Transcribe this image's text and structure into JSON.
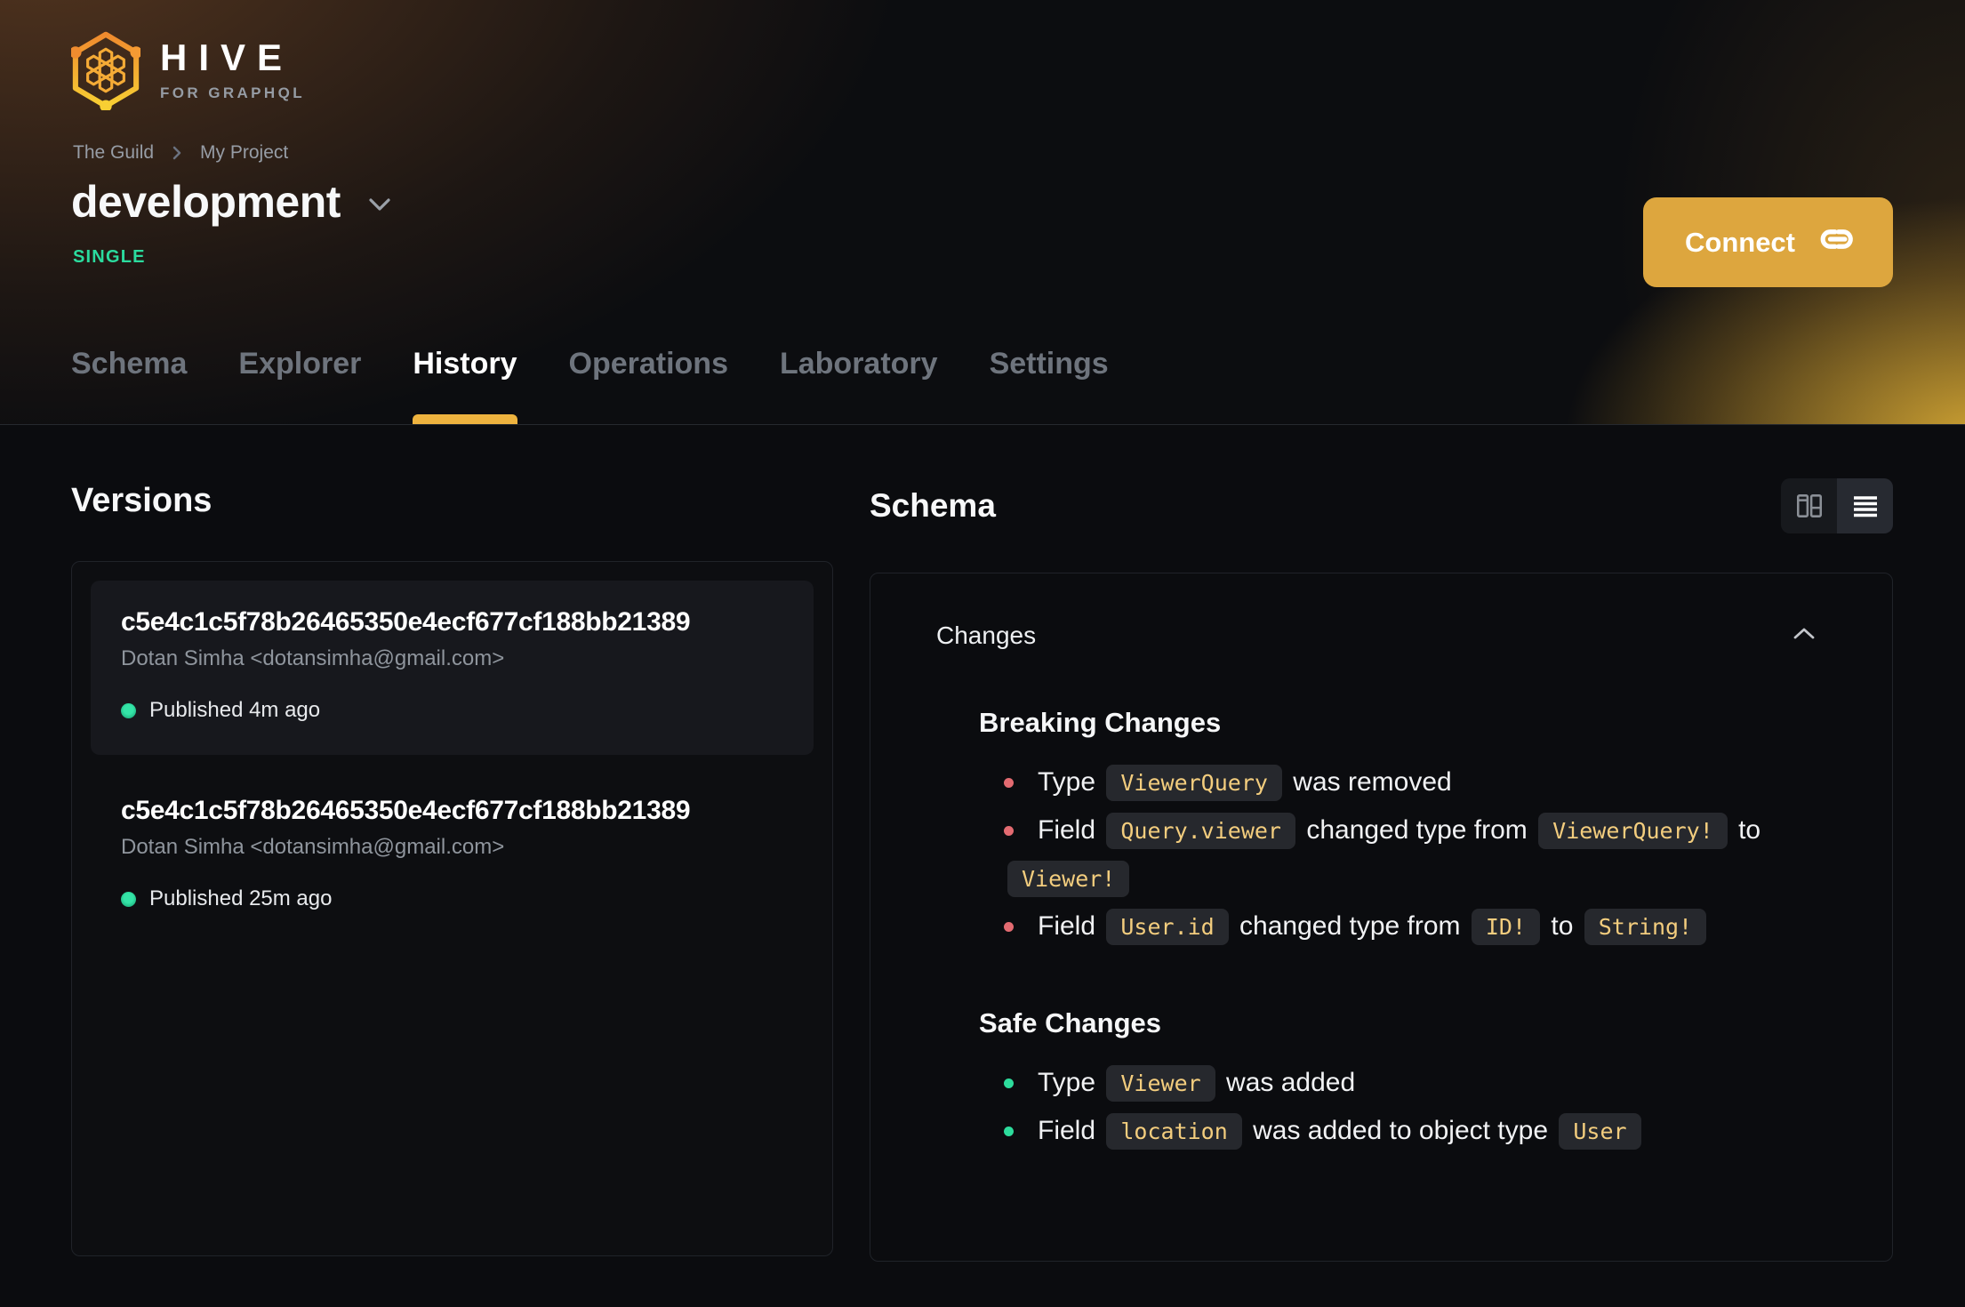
{
  "colors": {
    "accent": "#eeb33f",
    "connect_button": "#dda63e",
    "badge_green": "#2bdb9e",
    "breaking_bullet": "#e36b71",
    "safe_bullet": "#2ddc9c",
    "code_text": "#f3cd7e"
  },
  "brand": {
    "name": "HIVE",
    "tagline": "FOR GRAPHQL"
  },
  "breadcrumb": [
    "The Guild",
    "My Project"
  ],
  "project": {
    "name": "development",
    "badge": "SINGLE"
  },
  "header": {
    "connect_label": "Connect"
  },
  "tabs": [
    {
      "label": "Schema",
      "active": false
    },
    {
      "label": "Explorer",
      "active": false
    },
    {
      "label": "History",
      "active": true
    },
    {
      "label": "Operations",
      "active": false
    },
    {
      "label": "Laboratory",
      "active": false
    },
    {
      "label": "Settings",
      "active": false
    }
  ],
  "versions": {
    "title": "Versions",
    "items": [
      {
        "hash": "c5e4c1c5f78b26465350e4ecf677cf188bb21389",
        "author": "Dotan Simha <dotansimha@gmail.com>",
        "status": "Published 4m ago",
        "selected": true
      },
      {
        "hash": "c5e4c1c5f78b26465350e4ecf677cf188bb21389",
        "author": "Dotan Simha <dotansimha@gmail.com>",
        "status": "Published 25m ago",
        "selected": false
      }
    ]
  },
  "schema": {
    "title": "Schema",
    "view_modes": [
      "split-view",
      "list-view"
    ],
    "active_view": "list-view",
    "changes": {
      "title": "Changes",
      "sections": [
        {
          "heading": "Breaking Changes",
          "kind": "breaking",
          "items": [
            [
              {
                "t": "text",
                "v": "Type "
              },
              {
                "t": "code",
                "v": "ViewerQuery"
              },
              {
                "t": "text",
                "v": " was removed"
              }
            ],
            [
              {
                "t": "text",
                "v": "Field "
              },
              {
                "t": "code",
                "v": "Query.viewer"
              },
              {
                "t": "text",
                "v": " changed type from "
              },
              {
                "t": "code",
                "v": "ViewerQuery!"
              },
              {
                "t": "text",
                "v": " to "
              },
              {
                "t": "code",
                "v": "Viewer!"
              }
            ],
            [
              {
                "t": "text",
                "v": "Field "
              },
              {
                "t": "code",
                "v": "User.id"
              },
              {
                "t": "text",
                "v": " changed type from "
              },
              {
                "t": "code",
                "v": "ID!"
              },
              {
                "t": "text",
                "v": " to "
              },
              {
                "t": "code",
                "v": "String!"
              }
            ]
          ]
        },
        {
          "heading": "Safe Changes",
          "kind": "safe",
          "items": [
            [
              {
                "t": "text",
                "v": "Type "
              },
              {
                "t": "code",
                "v": "Viewer"
              },
              {
                "t": "text",
                "v": " was added"
              }
            ],
            [
              {
                "t": "text",
                "v": "Field "
              },
              {
                "t": "code",
                "v": "location"
              },
              {
                "t": "text",
                "v": " was added to object type "
              },
              {
                "t": "code",
                "v": "User"
              }
            ]
          ]
        }
      ]
    }
  }
}
